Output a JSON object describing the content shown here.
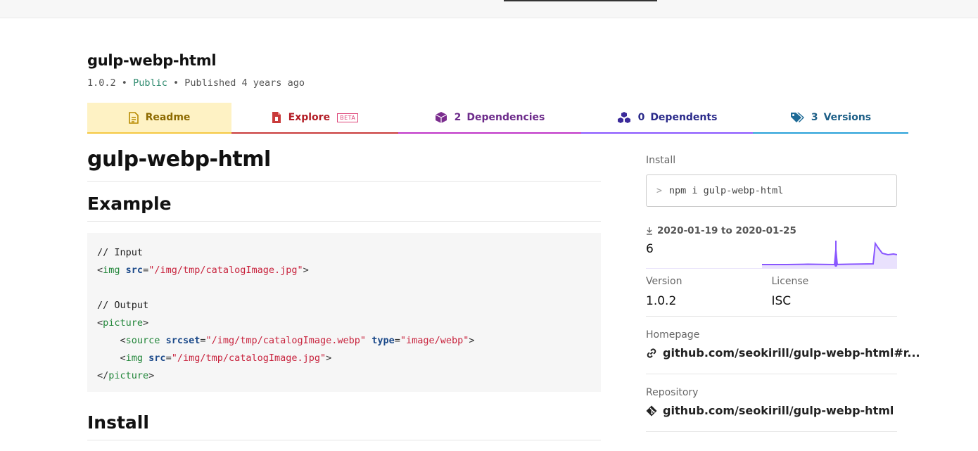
{
  "package": {
    "name": "gulp-webp-html",
    "version": "1.0.2",
    "visibility": "Public",
    "published": "Published 4 years ago",
    "separator": "•"
  },
  "tabs": {
    "readme": "Readme",
    "explore": "Explore",
    "explore_badge": "BETA",
    "dependencies_count": "2",
    "dependencies": "Dependencies",
    "dependents_count": "0",
    "dependents": "Dependents",
    "versions_count": "3",
    "versions": "Versions"
  },
  "readme": {
    "title": "gulp-webp-html",
    "example_heading": "Example",
    "install_heading": "Install",
    "code": {
      "c1": "// Input",
      "c2": "// Output",
      "src_attr": "src",
      "srcset_attr": "srcset",
      "type_attr": "type",
      "img_tag": "img",
      "picture_tag": "picture",
      "source_tag": "source",
      "jpg_path": "\"/img/tmp/catalogImage.jpg\"",
      "webp_path": "\"/img/tmp/catalogImage.webp\"",
      "webp_type": "\"image/webp\""
    }
  },
  "sidebar": {
    "install_label": "Install",
    "install_command": "npm i gulp-webp-html",
    "prompt_symbol": ">",
    "downloads_range": "2020-01-19 to 2020-01-25",
    "downloads_count": "6",
    "version_label": "Version",
    "version_value": "1.0.2",
    "license_label": "License",
    "license_value": "ISC",
    "homepage_label": "Homepage",
    "homepage_value": "github.com/seokirill/gulp-webp-html#r...",
    "repository_label": "Repository",
    "repository_value": "github.com/seokirill/gulp-webp-html"
  },
  "colors": {
    "readme_accent": "#f5c842",
    "explore_accent": "#c93b3b",
    "deps_accent": "#c035c8",
    "dependents_accent": "#8956ff",
    "versions_accent": "#29a1d9",
    "sparkline": "#8956ff"
  }
}
